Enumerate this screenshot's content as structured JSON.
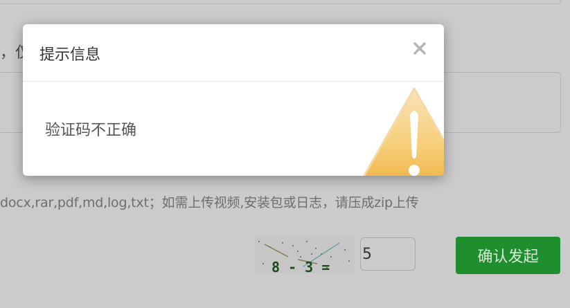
{
  "background_form": {
    "label_fragment": "，仅",
    "upload_hint": "docx,rar,pdf,md,log,txt；如需上传视频,安装包或日志，请压成zip上传",
    "captcha_text": "8 - 3 =",
    "captcha_answer": "5",
    "submit_label": "确认发起"
  },
  "modal": {
    "title": "提示信息",
    "message": "验证码不正确",
    "close_icon": "close-icon",
    "warning_icon": "warning-triangle-icon"
  },
  "colors": {
    "overlay_bg": "#cbcbcb",
    "submit_bg": "#1f8e2f",
    "warning_gold": "#f2b84b"
  }
}
